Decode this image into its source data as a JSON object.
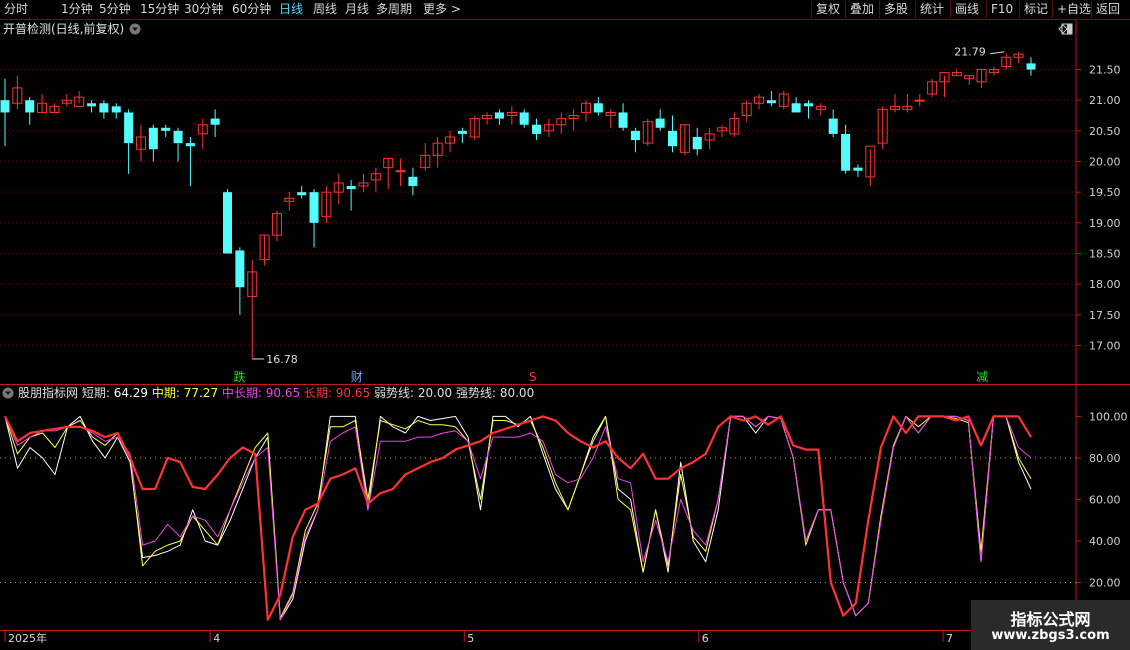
{
  "toolbar": {
    "left": [
      {
        "label": "分时"
      },
      {
        "label": "1分钟"
      },
      {
        "label": "5分钟"
      },
      {
        "label": "15分钟"
      },
      {
        "label": "30分钟"
      },
      {
        "label": "60分钟"
      },
      {
        "label": "日线",
        "active": true
      },
      {
        "label": "周线"
      },
      {
        "label": "月线"
      },
      {
        "label": "多周期"
      },
      {
        "label": "更多 >"
      }
    ],
    "right": [
      {
        "label": "复权"
      },
      {
        "label": "叠加"
      },
      {
        "label": "多股"
      },
      {
        "label": "统计"
      },
      {
        "label": "画线"
      },
      {
        "label": "F10"
      },
      {
        "label": "标记"
      },
      {
        "label": "+自选"
      },
      {
        "label": "返回"
      }
    ]
  },
  "main_panel": {
    "title": "开普检测(日线,前复权)",
    "high_label": "21.79",
    "low_label": "16.78",
    "event_markers": [
      {
        "text": "跌",
        "color": "#22dd22",
        "x_index": 12
      },
      {
        "text": "财",
        "color": "#6aa8ff",
        "x_index": 18
      },
      {
        "text": "S",
        "color": "#ff3333",
        "x_index": 27
      },
      {
        "text": "减",
        "color": "#22dd22",
        "x_index": 50
      }
    ]
  },
  "indicator": {
    "name": "股朋指标网",
    "items": [
      {
        "label": "短期:",
        "value": "64.29",
        "color": "#ffffff",
        "label_color": "#dddddd"
      },
      {
        "label": "中期:",
        "value": "77.27",
        "color": "#ffff44",
        "label_color": "#ffff44"
      },
      {
        "label": "中长期:",
        "value": "90.65",
        "color": "#ee44ee",
        "label_color": "#ee44ee"
      },
      {
        "label": "长期:",
        "value": "90.65",
        "color": "#ff3333",
        "label_color": "#ff3333"
      },
      {
        "label": "弱势线:",
        "value": "20.00",
        "color": "#dddddd",
        "label_color": "#dddddd"
      },
      {
        "label": "强势线:",
        "value": "80.00",
        "color": "#dddddd",
        "label_color": "#dddddd"
      }
    ]
  },
  "x_axis": {
    "labels": [
      {
        "text": "2025年",
        "x_index": 0
      },
      {
        "text": "4",
        "x_index": 10.5
      },
      {
        "text": "5",
        "x_index": 23.5
      },
      {
        "text": "6",
        "x_index": 35.5
      },
      {
        "text": "7",
        "x_index": 48
      }
    ]
  },
  "watermark": {
    "title": "指标公式网",
    "url": "www.zbgs3.com"
  },
  "colors": {
    "up": "#ff3232",
    "down": "#54fcfc",
    "grid": "#6a0f0f",
    "axis": "#c41818"
  },
  "chart_data": [
    {
      "type": "candlestick",
      "title": "开普检测(日线,前复权)",
      "y_ticks": [
        17.0,
        17.5,
        18.0,
        18.5,
        19.0,
        19.5,
        20.0,
        20.5,
        21.0,
        21.5
      ],
      "ylim": [
        16.6,
        21.9
      ],
      "candles": [
        [
          21.0,
          21.35,
          20.25,
          20.8
        ],
        [
          20.95,
          21.4,
          20.85,
          21.2
        ],
        [
          21.0,
          21.05,
          20.6,
          20.8
        ],
        [
          20.8,
          21.1,
          20.8,
          20.95
        ],
        [
          20.8,
          20.95,
          20.8,
          20.9
        ],
        [
          20.95,
          21.1,
          20.9,
          21.0
        ],
        [
          20.9,
          21.15,
          20.95,
          21.05
        ],
        [
          20.95,
          21.0,
          20.8,
          20.9
        ],
        [
          20.95,
          21.0,
          20.7,
          20.8
        ],
        [
          20.9,
          20.95,
          20.7,
          20.8
        ],
        [
          20.8,
          20.85,
          19.8,
          20.3
        ],
        [
          20.2,
          20.6,
          20.0,
          20.4
        ],
        [
          20.55,
          20.6,
          20.0,
          20.2
        ],
        [
          20.55,
          20.6,
          20.4,
          20.5
        ],
        [
          20.5,
          20.55,
          20.0,
          20.3
        ],
        [
          20.3,
          20.4,
          19.6,
          20.25
        ],
        [
          20.45,
          20.7,
          20.2,
          20.6
        ],
        [
          20.7,
          20.85,
          20.4,
          20.6
        ],
        [
          19.5,
          19.55,
          18.5,
          18.5
        ],
        [
          18.55,
          18.6,
          17.5,
          17.95
        ],
        [
          17.8,
          18.4,
          16.78,
          18.2
        ],
        [
          18.4,
          18.8,
          18.3,
          18.8
        ],
        [
          18.8,
          19.2,
          18.7,
          19.15
        ],
        [
          19.35,
          19.5,
          19.2,
          19.4
        ],
        [
          19.5,
          19.6,
          19.4,
          19.45
        ],
        [
          19.5,
          19.55,
          18.6,
          19.0
        ],
        [
          19.1,
          19.6,
          19.0,
          19.5
        ],
        [
          19.5,
          19.8,
          19.3,
          19.65
        ],
        [
          19.6,
          19.7,
          19.2,
          19.55
        ],
        [
          19.6,
          19.8,
          19.5,
          19.65
        ],
        [
          19.7,
          19.9,
          19.5,
          19.8
        ],
        [
          19.9,
          20.05,
          19.55,
          20.05
        ],
        [
          19.85,
          20.05,
          19.6,
          19.85
        ],
        [
          19.75,
          19.9,
          19.45,
          19.6
        ],
        [
          19.9,
          20.3,
          19.85,
          20.1
        ],
        [
          20.1,
          20.4,
          19.9,
          20.3
        ],
        [
          20.3,
          20.5,
          20.15,
          20.4
        ],
        [
          20.5,
          20.55,
          20.3,
          20.45
        ],
        [
          20.4,
          20.75,
          20.35,
          20.7
        ],
        [
          20.7,
          20.8,
          20.6,
          20.75
        ],
        [
          20.8,
          20.85,
          20.6,
          20.7
        ],
        [
          20.75,
          20.9,
          20.6,
          20.8
        ],
        [
          20.8,
          20.85,
          20.55,
          20.6
        ],
        [
          20.6,
          20.7,
          20.35,
          20.45
        ],
        [
          20.5,
          20.7,
          20.4,
          20.6
        ],
        [
          20.6,
          20.8,
          20.45,
          20.7
        ],
        [
          20.7,
          20.85,
          20.5,
          20.75
        ],
        [
          20.8,
          21.0,
          20.65,
          20.95
        ],
        [
          20.95,
          21.05,
          20.75,
          20.8
        ],
        [
          20.75,
          20.85,
          20.55,
          20.8
        ],
        [
          20.8,
          20.95,
          20.5,
          20.55
        ],
        [
          20.5,
          20.55,
          20.15,
          20.35
        ],
        [
          20.3,
          20.7,
          20.25,
          20.65
        ],
        [
          20.7,
          20.85,
          20.5,
          20.55
        ],
        [
          20.5,
          20.75,
          20.15,
          20.25
        ],
        [
          20.15,
          20.6,
          20.1,
          20.6
        ],
        [
          20.4,
          20.55,
          20.1,
          20.2
        ],
        [
          20.35,
          20.55,
          20.2,
          20.45
        ],
        [
          20.5,
          20.6,
          20.4,
          20.55
        ],
        [
          20.45,
          20.8,
          20.4,
          20.7
        ],
        [
          20.75,
          21.0,
          20.65,
          20.95
        ],
        [
          20.95,
          21.1,
          20.85,
          21.05
        ],
        [
          21.0,
          21.15,
          20.9,
          20.95
        ],
        [
          20.9,
          21.15,
          20.85,
          21.1
        ],
        [
          20.95,
          21.05,
          20.8,
          20.8
        ],
        [
          20.95,
          21.0,
          20.7,
          20.9
        ],
        [
          20.85,
          20.95,
          20.75,
          20.9
        ],
        [
          20.7,
          20.85,
          20.4,
          20.45
        ],
        [
          20.45,
          20.6,
          19.8,
          19.85
        ],
        [
          19.9,
          19.95,
          19.75,
          19.85
        ],
        [
          19.75,
          20.2,
          19.6,
          20.25
        ],
        [
          20.3,
          20.9,
          20.2,
          20.85
        ],
        [
          20.85,
          21.1,
          20.8,
          20.9
        ],
        [
          20.85,
          21.1,
          20.8,
          20.9
        ],
        [
          21.0,
          21.1,
          20.9,
          21.0
        ],
        [
          21.1,
          21.35,
          21.05,
          21.3
        ],
        [
          21.3,
          21.4,
          21.05,
          21.45
        ],
        [
          21.4,
          21.5,
          21.4,
          21.45
        ],
        [
          21.35,
          21.4,
          21.25,
          21.4
        ],
        [
          21.3,
          21.5,
          21.2,
          21.5
        ],
        [
          21.45,
          21.55,
          21.4,
          21.5
        ],
        [
          21.55,
          21.75,
          21.5,
          21.7
        ],
        [
          21.7,
          21.79,
          21.6,
          21.75
        ],
        [
          21.6,
          21.7,
          21.4,
          21.5
        ]
      ]
    },
    {
      "type": "line",
      "title": "股朋指标网",
      "y_ticks": [
        20.0,
        40.0,
        60.0,
        80.0,
        100.0
      ],
      "ylim": [
        0,
        105
      ],
      "reference_lines": [
        20,
        80
      ],
      "series": [
        {
          "name": "短期",
          "color": "#ffffff",
          "values": [
            100,
            75,
            85,
            80,
            72,
            95,
            100,
            88,
            80,
            90,
            78,
            32,
            33,
            35,
            38,
            55,
            40,
            38,
            50,
            65,
            80,
            90,
            2,
            12,
            40,
            55,
            100,
            100,
            100,
            55,
            100,
            95,
            92,
            100,
            98,
            99,
            100,
            90,
            55,
            100,
            100,
            95,
            100,
            82,
            65,
            55,
            72,
            90,
            100,
            65,
            60,
            25,
            55,
            25,
            78,
            40,
            30,
            55,
            100,
            100,
            92,
            100,
            99,
            80,
            40,
            55,
            55,
            20,
            4,
            10,
            50,
            85,
            100,
            92,
            100,
            100,
            100,
            98,
            30,
            100,
            100,
            78,
            65
          ]
        },
        {
          "name": "中期",
          "color": "#ffff44",
          "values": [
            100,
            82,
            90,
            92,
            85,
            95,
            98,
            90,
            86,
            92,
            80,
            28,
            35,
            38,
            40,
            52,
            45,
            38,
            55,
            70,
            85,
            92,
            3,
            15,
            45,
            58,
            95,
            95,
            98,
            60,
            98,
            96,
            94,
            98,
            96,
            96,
            95,
            88,
            60,
            98,
            98,
            96,
            98,
            85,
            68,
            55,
            72,
            88,
            100,
            60,
            55,
            25,
            55,
            28,
            72,
            42,
            35,
            60,
            100,
            100,
            95,
            100,
            99,
            80,
            38,
            55,
            55,
            20,
            4,
            10,
            52,
            86,
            100,
            95,
            100,
            100,
            99,
            97,
            35,
            100,
            100,
            80,
            70
          ]
        },
        {
          "name": "中长期",
          "color": "#ee44ee",
          "values": [
            100,
            86,
            90,
            93,
            93,
            95,
            95,
            92,
            88,
            90,
            82,
            38,
            40,
            48,
            42,
            52,
            50,
            42,
            55,
            68,
            80,
            85,
            2,
            14,
            42,
            55,
            88,
            92,
            95,
            55,
            88,
            88,
            88,
            90,
            90,
            92,
            93,
            88,
            70,
            90,
            90,
            90,
            92,
            88,
            72,
            68,
            70,
            80,
            95,
            70,
            68,
            30,
            50,
            30,
            60,
            45,
            38,
            60,
            100,
            100,
            95,
            100,
            99,
            80,
            40,
            55,
            55,
            20,
            4,
            10,
            50,
            85,
            100,
            92,
            100,
            100,
            100,
            98,
            30,
            100,
            100,
            85,
            80
          ]
        },
        {
          "name": "长期",
          "color": "#ff3333",
          "values": [
            100,
            88,
            92,
            93,
            94,
            95,
            95,
            93,
            90,
            92,
            80,
            65,
            65,
            80,
            78,
            66,
            65,
            72,
            80,
            85,
            82,
            2,
            14,
            42,
            55,
            58,
            70,
            72,
            75,
            58,
            63,
            65,
            72,
            75,
            78,
            80,
            84,
            86,
            88,
            92,
            94,
            96,
            98,
            100,
            98,
            92,
            88,
            85,
            88,
            80,
            75,
            82,
            70,
            70,
            75,
            78,
            82,
            95,
            100,
            98,
            100,
            96,
            100,
            86,
            84,
            84,
            20,
            4,
            10,
            50,
            85,
            100,
            92,
            100,
            100,
            100,
            98,
            100,
            86,
            100,
            100,
            100,
            90
          ]
        }
      ]
    }
  ]
}
